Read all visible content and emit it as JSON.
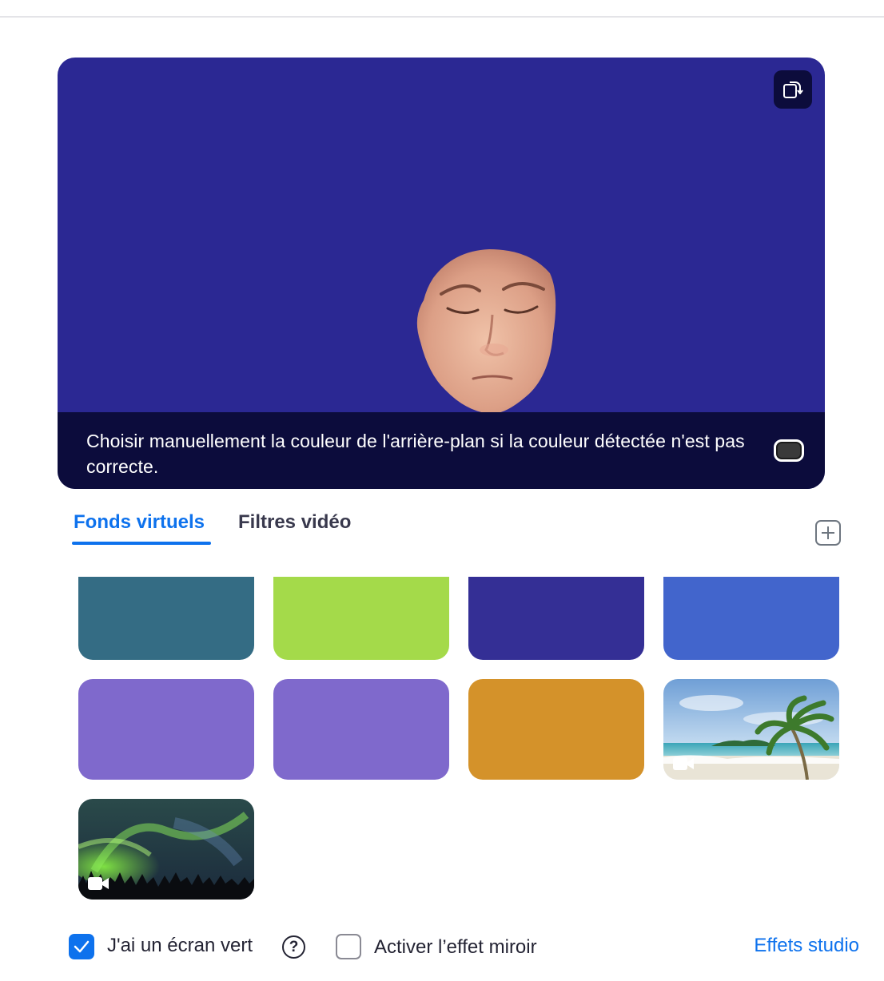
{
  "preview": {
    "background_color": "#2b2893",
    "rotate_icon": "rotate-camera-icon",
    "notice_text": "Choisir manuellement la couleur de l'arrière-plan si la couleur détectée n'est pas correcte.",
    "toggle_state": "off"
  },
  "tabs": [
    {
      "label": "Fonds virtuels",
      "active": true
    },
    {
      "label": "Filtres vidéo",
      "active": false
    }
  ],
  "add_icon": "plus-icon",
  "backgrounds": [
    {
      "type": "color",
      "color": "#346c84"
    },
    {
      "type": "color",
      "color": "#a4da4a"
    },
    {
      "type": "color",
      "color": "#342f95"
    },
    {
      "type": "color",
      "color": "#4265cc"
    },
    {
      "type": "color",
      "color": "#7f69cc"
    },
    {
      "type": "color",
      "color": "#7f69cc"
    },
    {
      "type": "color",
      "color": "#d4922a"
    },
    {
      "type": "video",
      "scene": "beach-palm"
    },
    {
      "type": "video",
      "scene": "aurora"
    }
  ],
  "options": {
    "green_screen": {
      "label": "J'ai un écran vert",
      "checked": true
    },
    "mirror": {
      "label": "Activer l’effet miroir",
      "checked": false
    },
    "help_glyph": "?"
  },
  "studio_link": "Effets studio"
}
